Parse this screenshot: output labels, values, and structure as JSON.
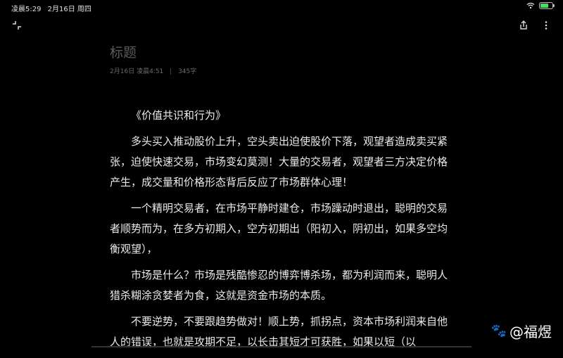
{
  "status": {
    "time": "凌晨5:29",
    "date": "2月16日 周四",
    "battery_percent": 70,
    "battery_color": "#4cd964"
  },
  "toolbar": {
    "collapse_icon": "collapse-icon",
    "share_icon": "share-icon",
    "more_icon": "more-vertical-icon"
  },
  "note": {
    "title": "标题",
    "meta_date": "2月16日",
    "meta_time": "凌晨4:51",
    "meta_sep": "|",
    "meta_count": "345字",
    "paragraphs": [
      "《价值共识和行为》",
      "多头买入推动股价上升，空头卖出迫使股价下落，观望者造成卖买紧张，迫使快速交易，市场变幻莫测！大量的交易者，观望者三方决定价格产生，成交量和价格形态背后反应了市场群体心理！",
      "一个精明交易者，在市场平静时建仓，市场躁动时退出，聪明的交易者顺势而为，在多方初期入，空方初期出（阳初入，阴初出，如果多空均衡观望），",
      "市场是什么？市场是残酷惨忍的博弈博杀场，都为利润而来，聪明人猎杀糊涂贪婪者为食，这就是资金市场的本质。",
      "不要逆势，不要跟趋势做对！顺上势，抓拐点，资本市场利润来自他人的错误，也就是攻期不足，以长击其短才可获胜，如果以短（以"
    ]
  },
  "watermark": {
    "text": "@福煜",
    "icon": "paw-icon"
  }
}
